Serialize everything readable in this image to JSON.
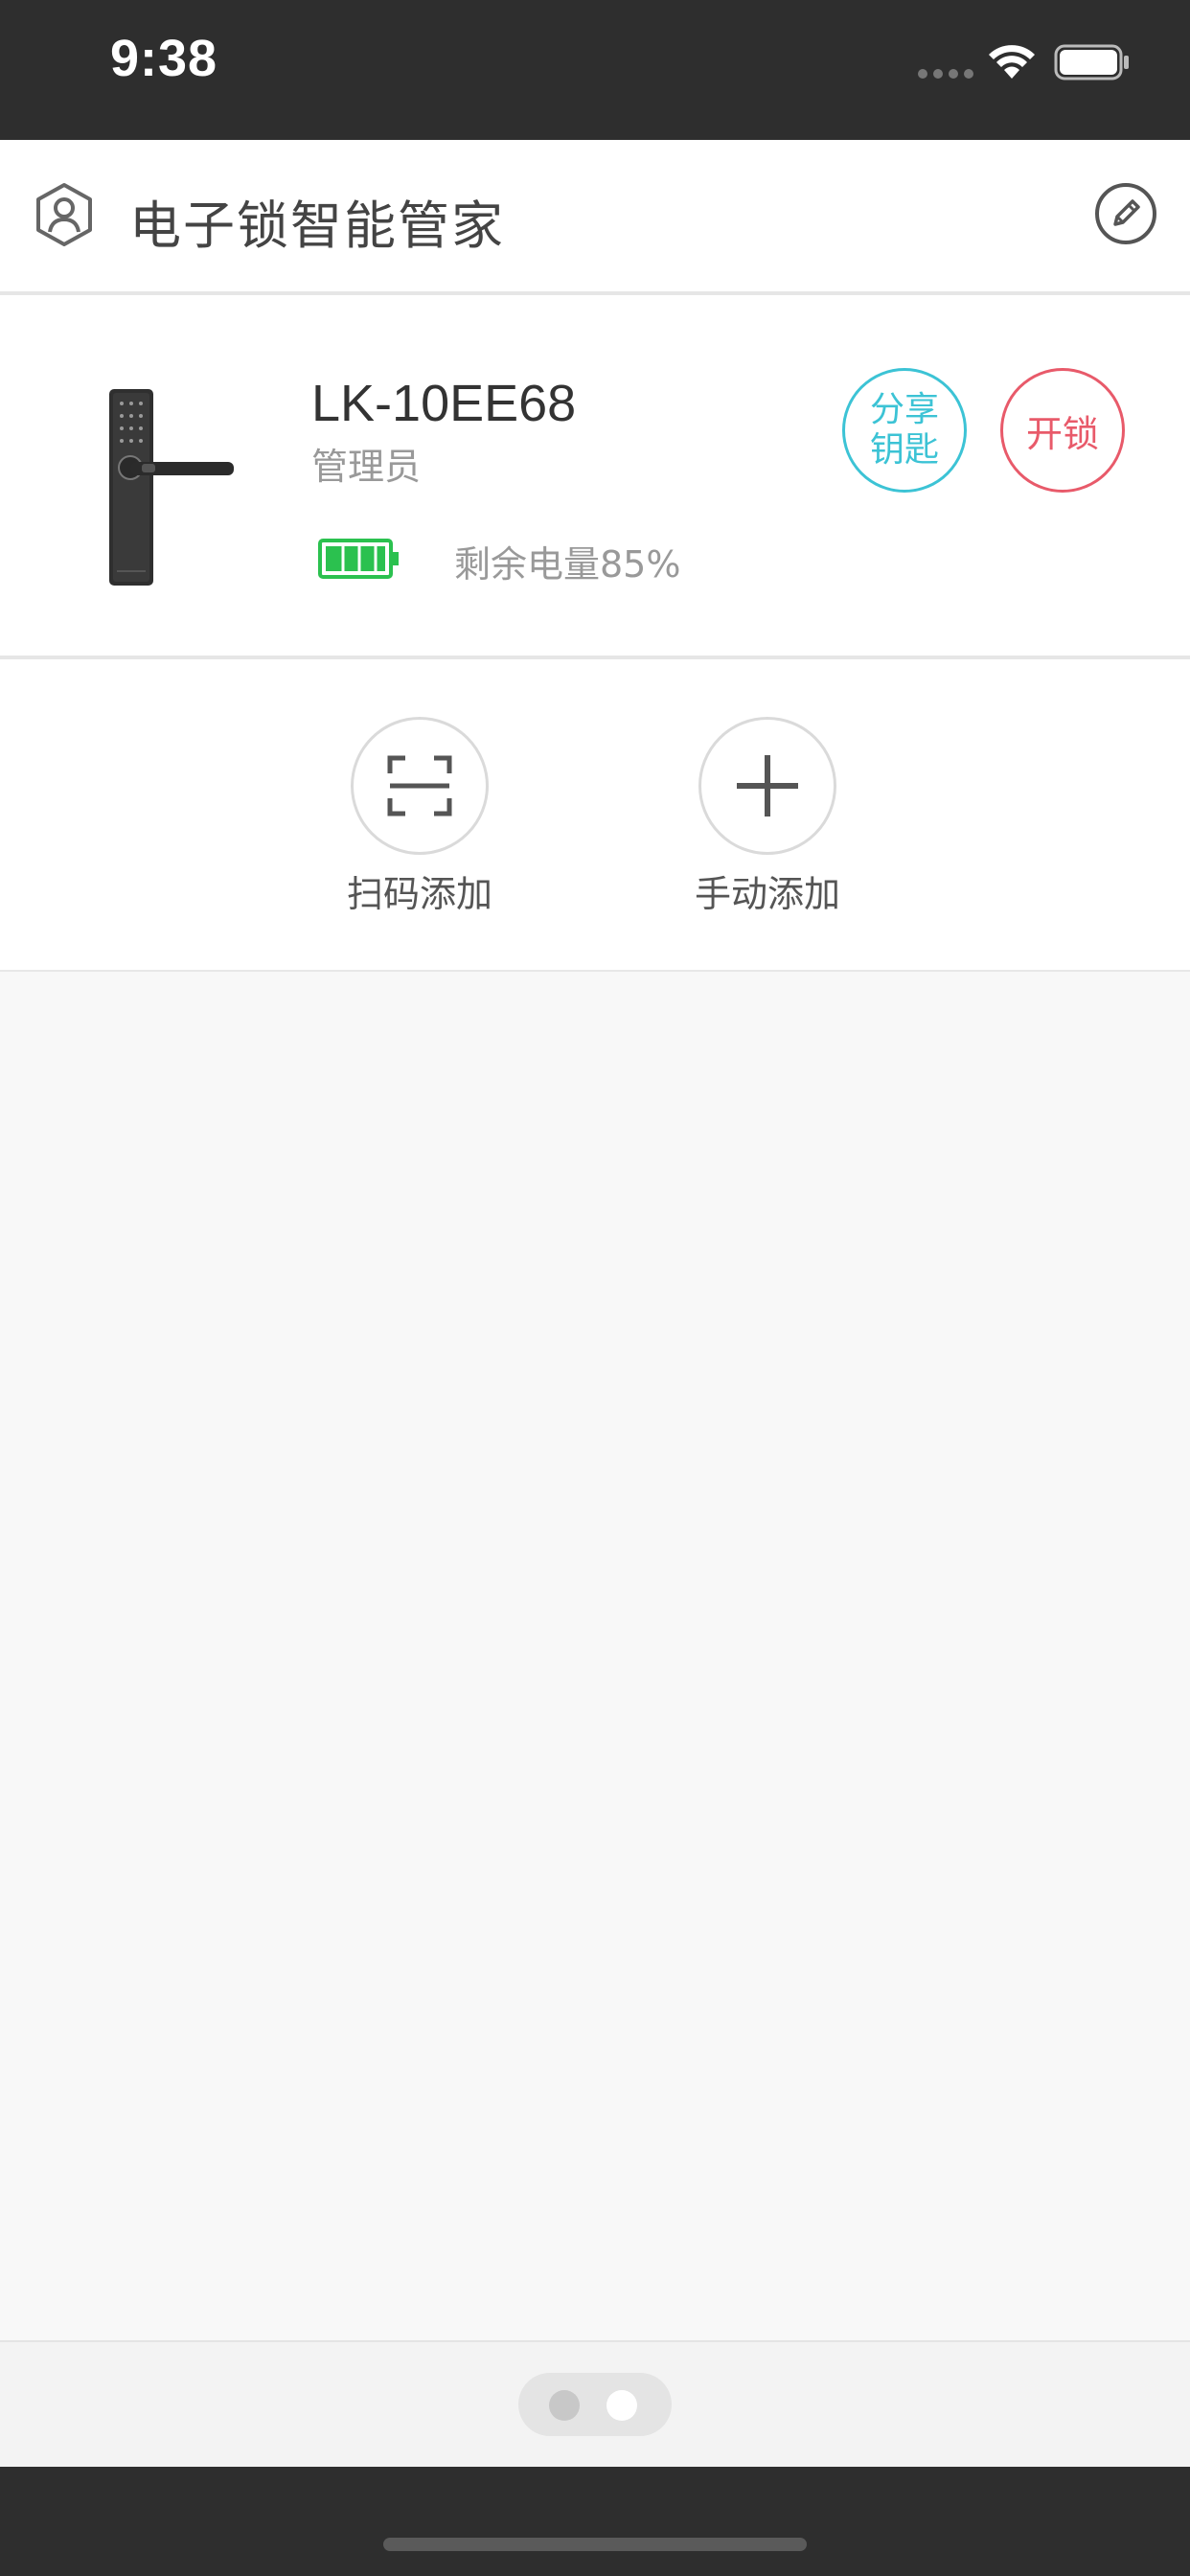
{
  "status_bar": {
    "time": "9:38"
  },
  "header": {
    "title": "电子锁智能管家",
    "profile_icon": "user-shield-icon",
    "edit_icon": "pencil-icon"
  },
  "device": {
    "name": "LK-10EE68",
    "role": "管理员",
    "battery_text": "剩余电量85%",
    "battery_level": 0.85,
    "share_key_line1": "分享",
    "share_key_line2": "钥匙",
    "unlock_label": "开锁"
  },
  "add_actions": {
    "scan_label": "扫码添加",
    "manual_label": "手动添加"
  },
  "page_indicator": {
    "current_page": 2,
    "total_pages": 2
  },
  "colors": {
    "share_accent": "#3cc3d5",
    "unlock_accent": "#e85a6a",
    "battery_green": "#2bc14f"
  }
}
